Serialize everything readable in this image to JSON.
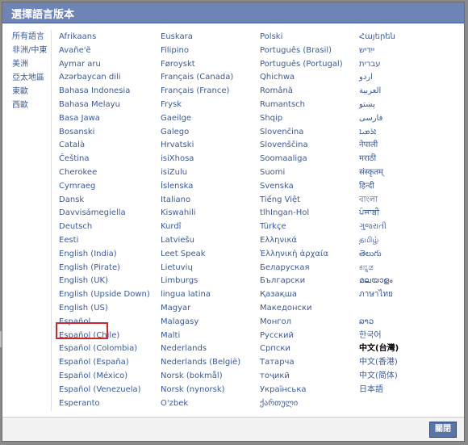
{
  "dialog": {
    "title": "選擇語言版本",
    "close_label": "關閉"
  },
  "regions": [
    "所有語言",
    "非洲/中東",
    "美洲",
    "亞太地區",
    "東歐",
    "西歐"
  ],
  "columns": [
    [
      "Afrikaans",
      "Avañe'ẽ",
      "Aymar aru",
      "Azərbaycan dili",
      "Bahasa Indonesia",
      "Bahasa Melayu",
      "Basa Jawa",
      "Bosanski",
      "Català",
      "Čeština",
      "Cherokee",
      "Cymraeg",
      "Dansk",
      "Davvisámegiella",
      "Deutsch",
      "Eesti",
      "English (India)",
      "English (Pirate)",
      "English (UK)",
      "English (Upside Down)",
      "English (US)",
      "Español",
      "Español (Chile)",
      "Español (Colombia)",
      "Español (España)",
      "Español (México)",
      "Español (Venezuela)",
      "Esperanto"
    ],
    [
      "Euskara",
      "Filipino",
      "Føroyskt",
      "Français (Canada)",
      "Français (France)",
      "Frysk",
      "Gaeilge",
      "Galego",
      "Hrvatski",
      "isiXhosa",
      "isiZulu",
      "Íslenska",
      "Italiano",
      "Kiswahili",
      "Kurdî",
      "Latviešu",
      "Leet Speak",
      "Lietuvių",
      "Limburgs",
      "lingua latina",
      "Magyar",
      "Malagasy",
      "Malti",
      "Nederlands",
      "Nederlands (België)",
      "Norsk (bokmål)",
      "Norsk (nynorsk)",
      "O'zbek"
    ],
    [
      "Polski",
      "Português (Brasil)",
      "Português (Portugal)",
      "Qhichwa",
      "Română",
      "Rumantsch",
      "Shqip",
      "Slovenčina",
      "Slovenščina",
      "Soomaaliga",
      "Suomi",
      "Svenska",
      "Tiếng Việt",
      "tlhIngan-Hol",
      "Türkçe",
      "Ελληνικά",
      "Ἑλληνικὴ ἀρχαία",
      "Беларуская",
      "Български",
      "Қазақша",
      "Македонски",
      "Монгол",
      "Русский",
      "Српски",
      "Татарча",
      "тоҷикӣ",
      "Українська",
      "ქართული"
    ],
    [
      "Հայերեն",
      "ייִדיש",
      "עברית",
      "اردو",
      "العربية",
      "پښتو",
      "فارسی",
      "ܐܪܡܝܐ",
      "नेपाली",
      "मराठी",
      "संस्कृतम्",
      "हिन्दी",
      "বাংলা",
      "ਪੰਜਾਬੀ",
      "ગુજરાતી",
      "தமிழ்",
      "తెలుగు",
      "ಕನ್ನಡ",
      "മലയാളം",
      "ภาษาไทย",
      "",
      "ລາວ",
      "한국어",
      "中文(台灣)",
      "中文(香港)",
      "中文(简体)",
      "日本語",
      ""
    ]
  ],
  "selected_language": "中文(台灣)",
  "highlighted_language": "English (US)"
}
